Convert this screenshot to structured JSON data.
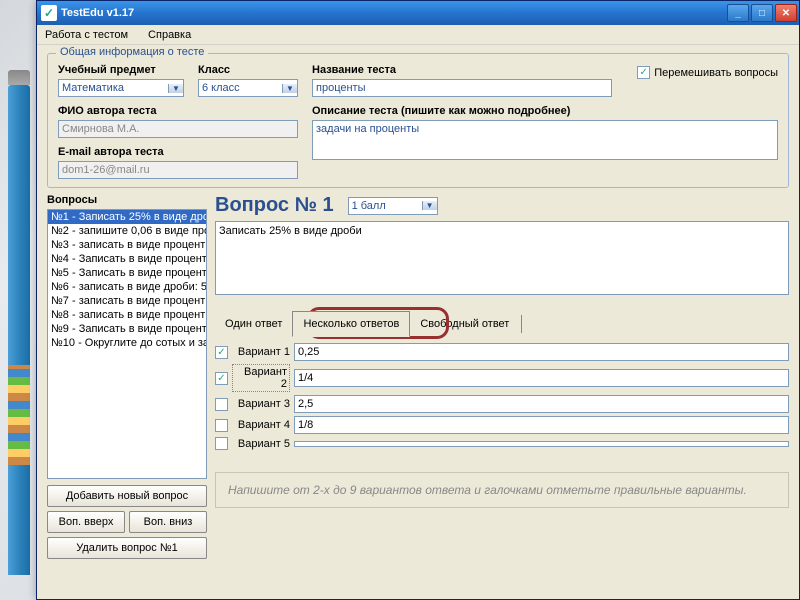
{
  "titlebar": {
    "title": "TestEdu v1.17"
  },
  "menu": {
    "item1": "Работа с тестом",
    "item2": "Справка"
  },
  "general": {
    "legend": "Общая информация о тесте",
    "subject_label": "Учебный предмет",
    "subject_value": "Математика",
    "class_label": "Класс",
    "class_value": "6 класс",
    "name_label": "Название теста",
    "name_value": "проценты",
    "shuffle_label": "Перемешивать вопросы",
    "author_label": "ФИО автора теста",
    "author_value": "Смирнова М.А.",
    "desc_label": "Описание теста (пишите как можно подробнее)",
    "desc_value": "задачи на проценты",
    "email_label": "E-mail автора теста",
    "email_value": "dom1-26@mail.ru"
  },
  "questions": {
    "label": "Вопросы",
    "items": [
      "№1 - Записать 25% в виде дро",
      "№2 - запишите 0,06 в виде про",
      "№3 - записать в виде процент",
      "№4 - Записать в виде процент",
      "№5 - Записать в виде процент",
      "№6 - записать в виде дроби: 5",
      "№7 - записать в виде процент",
      "№8 - записать в виде процент",
      "№9 - Записать в виде процент",
      "№10 - Округлите до сотых и за"
    ],
    "add_btn": "Добавить новый вопрос",
    "up_btn": "Воп. вверх",
    "down_btn": "Воп. вниз",
    "delete_btn": "Удалить вопрос №1"
  },
  "editor": {
    "title": "Вопрос № 1",
    "points": "1 балл",
    "text": "Записать 25% в виде дроби",
    "tab1": "Один ответ",
    "tab2": "Несколько ответов",
    "tab3": "Свободный ответ",
    "variants": [
      {
        "label": "Вариант 1",
        "value": "0,25",
        "checked": true
      },
      {
        "label": "Вариант 2",
        "value": "1/4",
        "checked": true
      },
      {
        "label": "Вариант 3",
        "value": "2,5",
        "checked": false
      },
      {
        "label": "Вариант 4",
        "value": "1/8",
        "checked": false
      },
      {
        "label": "Вариант 5",
        "value": "",
        "checked": false
      }
    ],
    "hint": "Напишите от 2-х до 9 вариантов ответа и галочками отметьте правильные варианты."
  }
}
